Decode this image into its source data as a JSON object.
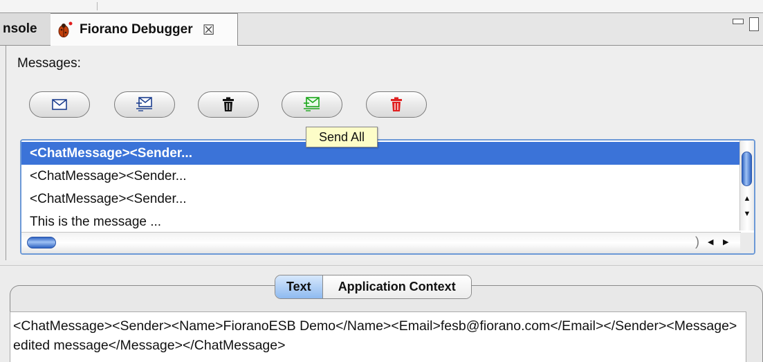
{
  "tabs": {
    "console_label": "nsole",
    "debugger_label": "Fiorano Debugger",
    "debugger_close_glyph": "☒"
  },
  "icons": {
    "debugger_tab": "ladybug-icon",
    "close_tab": "close-icon",
    "minimize": "minimize-icon",
    "maximize": "maximize-icon",
    "buttons": [
      "envelope-icon",
      "envelope-send-icon",
      "trash-icon",
      "envelope-send-all-icon",
      "trash-all-icon"
    ]
  },
  "colors": {
    "selection": "#3b73d8",
    "send_all_green": "#1aa61a",
    "delete_all_red": "#e02020",
    "tooltip_bg": "#fdfdc8"
  },
  "messages": {
    "label": "Messages:",
    "tooltip": "Send All",
    "items": [
      {
        "text": "<ChatMessage><Sender...",
        "selected": true
      },
      {
        "text": "<ChatMessage><Sender...",
        "selected": false
      },
      {
        "text": "<ChatMessage><Sender...",
        "selected": false
      },
      {
        "text": "This is the message ...",
        "selected": false
      }
    ]
  },
  "viewer": {
    "tab_text": "Text",
    "tab_app_context": "Application Context",
    "content": "<ChatMessage><Sender><Name>FioranoESB Demo</Name><Email>fesb@fiorano.com</Email></Sender><Message>edited message</Message></ChatMessage>"
  }
}
